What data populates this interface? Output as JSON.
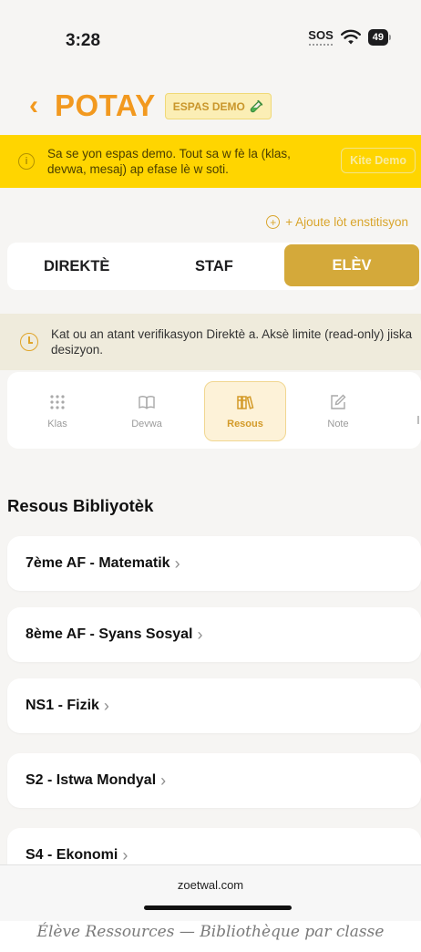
{
  "status_bar": {
    "time": "3:28",
    "sos": "SOS",
    "battery": "49"
  },
  "header": {
    "back_icon": "chevron-left-icon",
    "title": "POTAY",
    "badge": "ESPAS DEMO",
    "badge_icon": "test-tube-icon"
  },
  "demo_banner": {
    "message": "Sa se yon espas demo. Tout sa w fè la (klas, devwa, mesaj) ap efase lè w soti.",
    "exit_button": "Kite Demo",
    "bg_color": "#ffd500"
  },
  "add_institution": "+ Ajoute lòt enstitisyon",
  "role_tabs": [
    {
      "label": "DIREKTÈ",
      "active": false
    },
    {
      "label": "STAF",
      "active": false
    },
    {
      "label": "ELÈV",
      "active": true
    }
  ],
  "verify_notice": "Kat ou an atant verifikasyon Direktè a. Aksè limite (read-only) jiska desizyon.",
  "modules": [
    {
      "label": "Klas",
      "icon": "grid-dots-icon",
      "active": false
    },
    {
      "label": "Devwa",
      "icon": "open-book-icon",
      "active": false
    },
    {
      "label": "Resous",
      "icon": "library-books-icon",
      "active": true
    },
    {
      "label": "Note",
      "icon": "edit-note-icon",
      "active": false
    }
  ],
  "section_title": "Resous Bibliyotèk",
  "resources": [
    {
      "label": "7ème AF - Matematik"
    },
    {
      "label": "8ème AF - Syans Sosyal"
    },
    {
      "label": "NS1 - Fizik"
    },
    {
      "label": "S2 - Istwa Mondyal"
    },
    {
      "label": "S4 - Ekonomi"
    }
  ],
  "browser": {
    "url": "zoetwal.com"
  },
  "caption": "Élève Ressources — Bibliothèque par classe",
  "colors": {
    "accent": "#f2991f",
    "active_tab": "#d4a93a"
  }
}
